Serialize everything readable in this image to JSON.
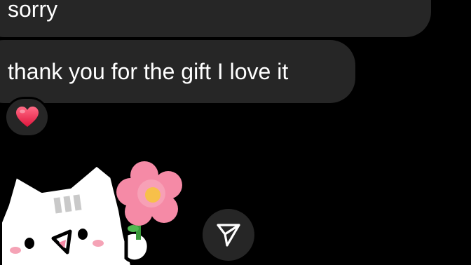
{
  "messages": [
    {
      "text": "sorry"
    },
    {
      "text": "thank you for the gift I love it"
    }
  ],
  "reaction": {
    "emoji": "heart",
    "color": "#f03a5f"
  },
  "sticker": {
    "name": "hello-kitty-holding-flower"
  },
  "share_button": {
    "icon": "send-icon"
  },
  "colors": {
    "background": "#000000",
    "bubble": "#262626",
    "text": "#ffffff",
    "flower_pink": "#f58aa6",
    "flower_center": "#f7c04a"
  }
}
